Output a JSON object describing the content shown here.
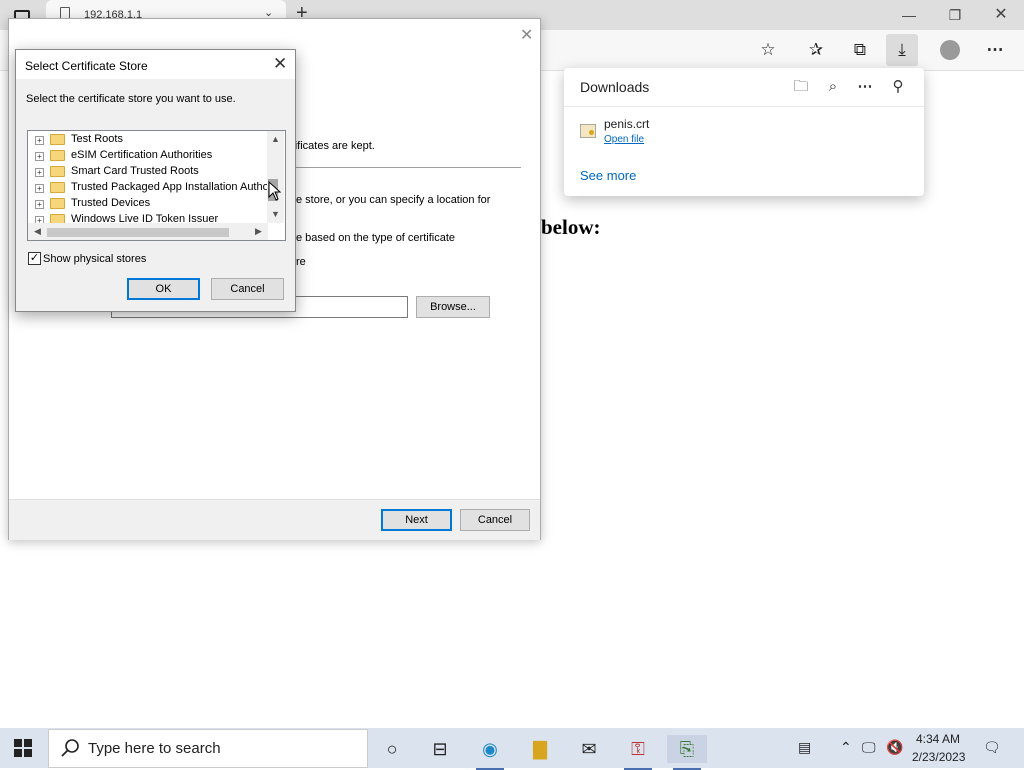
{
  "browser": {
    "tab_title": "192.168.1.1",
    "downloads": {
      "title": "Downloads",
      "file_name": "penis.crt",
      "open_file": "Open file",
      "see_more": "See more"
    },
    "page_heading": "below:"
  },
  "wizard": {
    "line1": "rtificates are kept.",
    "line2": "e store, or you can specify a location for",
    "line3": "e based on the type of certificate",
    "line4": "re",
    "browse_label": "Browse...",
    "next_label": "Next",
    "cancel_label": "Cancel"
  },
  "dialog": {
    "title": "Select Certificate Store",
    "instruction": "Select the certificate store you want to use.",
    "tree_items": [
      "Test Roots",
      "eSIM Certification Authorities",
      "Smart Card Trusted Roots",
      "Trusted Packaged App Installation Autho",
      "Trusted Devices",
      "Windows Live ID Token Issuer"
    ],
    "show_physical_label": "Show physical stores",
    "show_physical_checked": true,
    "ok_label": "OK",
    "cancel_label": "Cancel"
  },
  "taskbar": {
    "search_placeholder": "Type here to search",
    "time": "4:34 AM",
    "date": "2/23/2023"
  }
}
